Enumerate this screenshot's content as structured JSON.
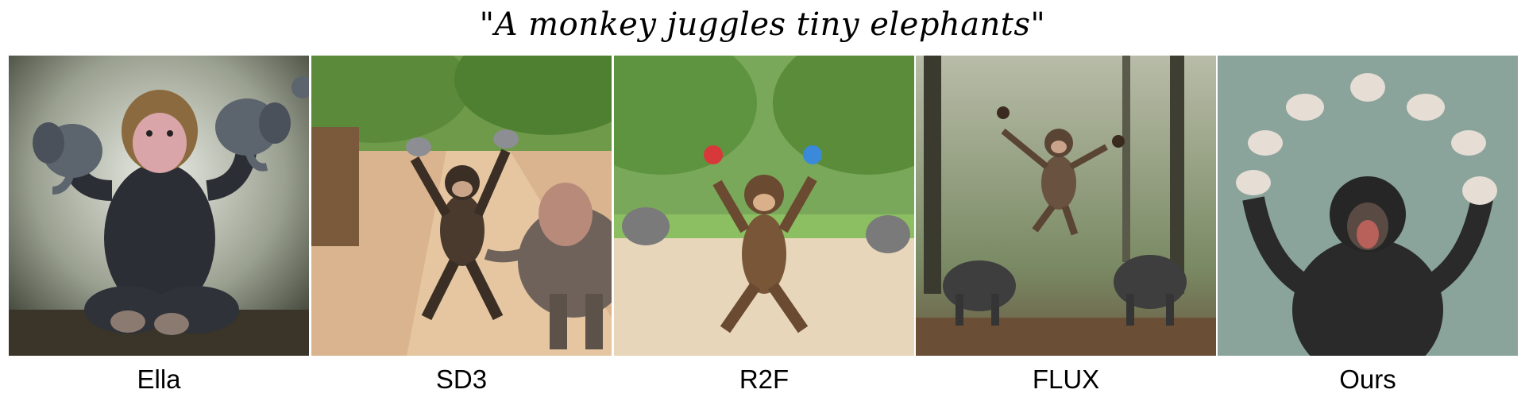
{
  "figure": {
    "caption": "\"A monkey juggles tiny elephants\"",
    "panels": [
      {
        "label": "Ella",
        "scene": "gray-monkey-holding-elephants"
      },
      {
        "label": "SD3",
        "scene": "chimp-on-dirt-path-with-elephant"
      },
      {
        "label": "R2F",
        "scene": "chimp-juggling-balls-in-park"
      },
      {
        "label": "FLUX",
        "scene": "monkey-leaping-in-forest"
      },
      {
        "label": "Ours",
        "scene": "chimp-juggling-elephant-figurines"
      }
    ]
  }
}
